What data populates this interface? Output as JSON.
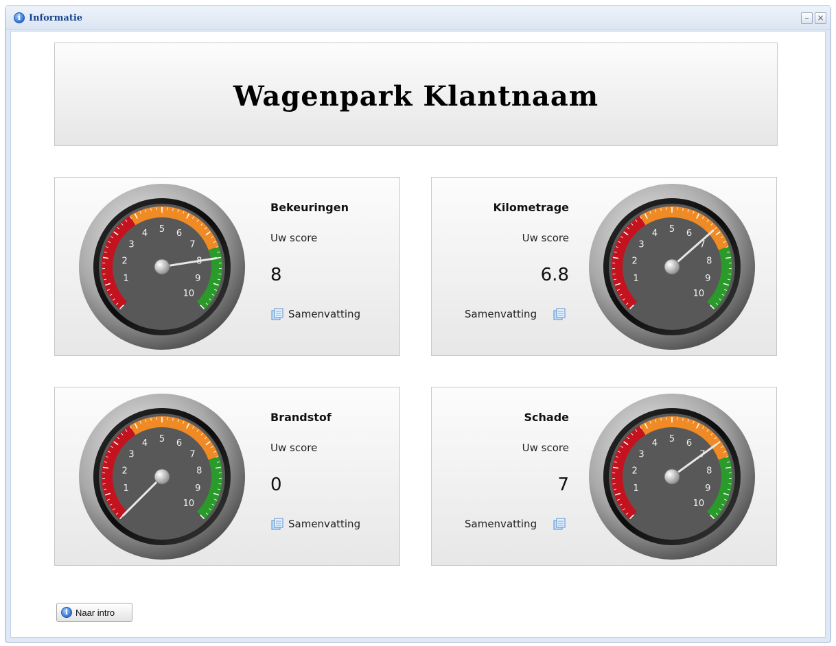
{
  "window": {
    "title": "Informatie",
    "minimize_symbol": "–",
    "close_symbol": "×"
  },
  "header": {
    "title": "Wagenpark Klantnaam"
  },
  "gauge_scale": {
    "min": 0,
    "max": 10,
    "ticks": [
      "1",
      "2",
      "3",
      "4",
      "5",
      "6",
      "7",
      "8",
      "9",
      "10"
    ]
  },
  "colors": {
    "red_zone": "#c4131f",
    "orange_zone": "#f08a24",
    "green_zone": "#2a9a2a",
    "dial_face": "#585858",
    "accent": "#15428b"
  },
  "cards": [
    {
      "title": "Bekeuringen",
      "subtitle": "Uw score",
      "score": "8",
      "value": 8,
      "summary": "Samenvatting"
    },
    {
      "title": "Kilometrage",
      "subtitle": "Uw score",
      "score": "6.8",
      "value": 6.8,
      "summary": "Samenvatting"
    },
    {
      "title": "Brandstof",
      "subtitle": "Uw score",
      "score": "0",
      "value": 0,
      "summary": "Samenvatting"
    },
    {
      "title": "Schade",
      "subtitle": "Uw score",
      "score": "7",
      "value": 7,
      "summary": "Samenvatting"
    }
  ],
  "footer": {
    "intro_button": "Naar intro"
  },
  "icons": {
    "info": "info-icon",
    "document": "document-icon",
    "minimize": "minimize-icon",
    "close": "close-icon"
  }
}
